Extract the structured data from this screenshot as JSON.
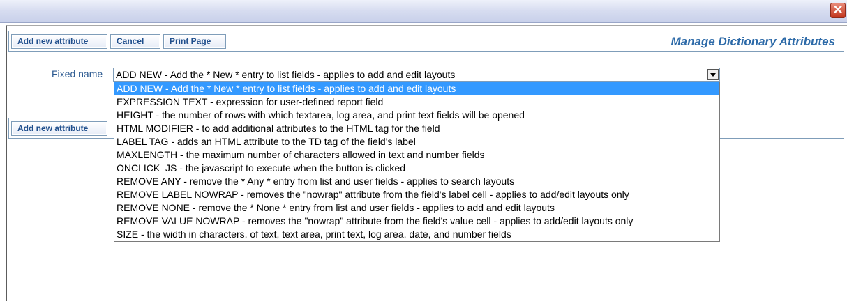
{
  "window": {
    "close_glyph": "✕"
  },
  "toolbar": {
    "add_label": "Add new attribute",
    "cancel_label": "Cancel",
    "print_label": "Print Page",
    "title": "Manage Dictionary Attributes"
  },
  "form": {
    "field_label": "Fixed name",
    "selected_value": "ADD NEW - Add the * New * entry to list fields - applies to add and edit layouts"
  },
  "toolbar2": {
    "add_label": "Add new attribute"
  },
  "dropdown": {
    "options": [
      "ADD NEW - Add the * New * entry to list fields - applies to add and edit layouts",
      "EXPRESSION TEXT - expression for user-defined report field",
      "HEIGHT - the number of rows with which textarea, log area, and print text fields will be opened",
      "HTML MODIFIER - to add additional attributes to the HTML tag for the field",
      "LABEL TAG - adds an HTML attribute to the TD tag of the field's label",
      "MAXLENGTH - the maximum number of characters allowed in text and number fields",
      "ONCLICK_JS - the javascript to execute when the button is clicked",
      "REMOVE ANY - remove the * Any * entry from list and user fields - applies to search layouts",
      "REMOVE LABEL NOWRAP - removes the \"nowrap\" attribute from the field's label cell - applies to add/edit layouts only",
      "REMOVE NONE - remove the * None * entry from list and user fields - applies to add and edit layouts",
      "REMOVE VALUE NOWRAP - removes the \"nowrap\" attribute from the field's value cell - applies to add/edit layouts only",
      "SIZE - the width in characters, of text, text area, print text, log area, date, and number fields"
    ]
  },
  "colors": {
    "accent": "#2d6aa8",
    "selected_bg": "#3399ff"
  }
}
